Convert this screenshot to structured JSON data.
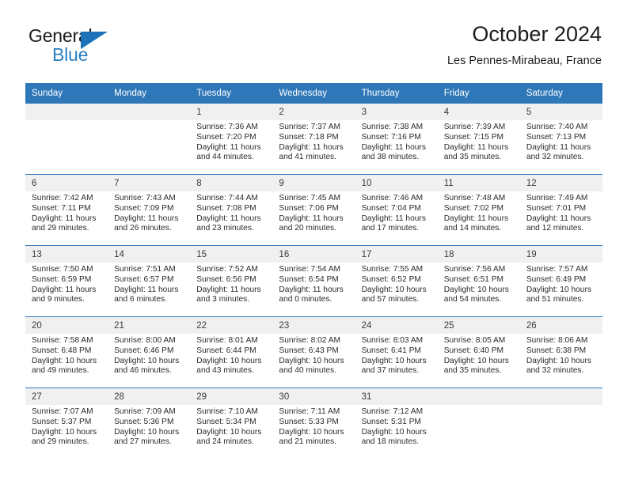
{
  "brand": {
    "name_top": "General",
    "name_bottom": "Blue",
    "triangle_color": "#1c72b8",
    "blue_text_color": "#2a7fc1"
  },
  "header": {
    "title": "October 2024",
    "subtitle": "Les Pennes-Mirabeau, France"
  },
  "theme": {
    "header_blue": "#2e77b8",
    "daynum_band": "#f0f0f0",
    "text": "#2b2b2b"
  },
  "weekdays": [
    "Sunday",
    "Monday",
    "Tuesday",
    "Wednesday",
    "Thursday",
    "Friday",
    "Saturday"
  ],
  "weeks": [
    [
      {
        "day": "",
        "lines": []
      },
      {
        "day": "",
        "lines": []
      },
      {
        "day": "1",
        "lines": [
          "Sunrise: 7:36 AM",
          "Sunset: 7:20 PM",
          "Daylight: 11 hours",
          "and 44 minutes."
        ]
      },
      {
        "day": "2",
        "lines": [
          "Sunrise: 7:37 AM",
          "Sunset: 7:18 PM",
          "Daylight: 11 hours",
          "and 41 minutes."
        ]
      },
      {
        "day": "3",
        "lines": [
          "Sunrise: 7:38 AM",
          "Sunset: 7:16 PM",
          "Daylight: 11 hours",
          "and 38 minutes."
        ]
      },
      {
        "day": "4",
        "lines": [
          "Sunrise: 7:39 AM",
          "Sunset: 7:15 PM",
          "Daylight: 11 hours",
          "and 35 minutes."
        ]
      },
      {
        "day": "5",
        "lines": [
          "Sunrise: 7:40 AM",
          "Sunset: 7:13 PM",
          "Daylight: 11 hours",
          "and 32 minutes."
        ]
      }
    ],
    [
      {
        "day": "6",
        "lines": [
          "Sunrise: 7:42 AM",
          "Sunset: 7:11 PM",
          "Daylight: 11 hours",
          "and 29 minutes."
        ]
      },
      {
        "day": "7",
        "lines": [
          "Sunrise: 7:43 AM",
          "Sunset: 7:09 PM",
          "Daylight: 11 hours",
          "and 26 minutes."
        ]
      },
      {
        "day": "8",
        "lines": [
          "Sunrise: 7:44 AM",
          "Sunset: 7:08 PM",
          "Daylight: 11 hours",
          "and 23 minutes."
        ]
      },
      {
        "day": "9",
        "lines": [
          "Sunrise: 7:45 AM",
          "Sunset: 7:06 PM",
          "Daylight: 11 hours",
          "and 20 minutes."
        ]
      },
      {
        "day": "10",
        "lines": [
          "Sunrise: 7:46 AM",
          "Sunset: 7:04 PM",
          "Daylight: 11 hours",
          "and 17 minutes."
        ]
      },
      {
        "day": "11",
        "lines": [
          "Sunrise: 7:48 AM",
          "Sunset: 7:02 PM",
          "Daylight: 11 hours",
          "and 14 minutes."
        ]
      },
      {
        "day": "12",
        "lines": [
          "Sunrise: 7:49 AM",
          "Sunset: 7:01 PM",
          "Daylight: 11 hours",
          "and 12 minutes."
        ]
      }
    ],
    [
      {
        "day": "13",
        "lines": [
          "Sunrise: 7:50 AM",
          "Sunset: 6:59 PM",
          "Daylight: 11 hours",
          "and 9 minutes."
        ]
      },
      {
        "day": "14",
        "lines": [
          "Sunrise: 7:51 AM",
          "Sunset: 6:57 PM",
          "Daylight: 11 hours",
          "and 6 minutes."
        ]
      },
      {
        "day": "15",
        "lines": [
          "Sunrise: 7:52 AM",
          "Sunset: 6:56 PM",
          "Daylight: 11 hours",
          "and 3 minutes."
        ]
      },
      {
        "day": "16",
        "lines": [
          "Sunrise: 7:54 AM",
          "Sunset: 6:54 PM",
          "Daylight: 11 hours",
          "and 0 minutes."
        ]
      },
      {
        "day": "17",
        "lines": [
          "Sunrise: 7:55 AM",
          "Sunset: 6:52 PM",
          "Daylight: 10 hours",
          "and 57 minutes."
        ]
      },
      {
        "day": "18",
        "lines": [
          "Sunrise: 7:56 AM",
          "Sunset: 6:51 PM",
          "Daylight: 10 hours",
          "and 54 minutes."
        ]
      },
      {
        "day": "19",
        "lines": [
          "Sunrise: 7:57 AM",
          "Sunset: 6:49 PM",
          "Daylight: 10 hours",
          "and 51 minutes."
        ]
      }
    ],
    [
      {
        "day": "20",
        "lines": [
          "Sunrise: 7:58 AM",
          "Sunset: 6:48 PM",
          "Daylight: 10 hours",
          "and 49 minutes."
        ]
      },
      {
        "day": "21",
        "lines": [
          "Sunrise: 8:00 AM",
          "Sunset: 6:46 PM",
          "Daylight: 10 hours",
          "and 46 minutes."
        ]
      },
      {
        "day": "22",
        "lines": [
          "Sunrise: 8:01 AM",
          "Sunset: 6:44 PM",
          "Daylight: 10 hours",
          "and 43 minutes."
        ]
      },
      {
        "day": "23",
        "lines": [
          "Sunrise: 8:02 AM",
          "Sunset: 6:43 PM",
          "Daylight: 10 hours",
          "and 40 minutes."
        ]
      },
      {
        "day": "24",
        "lines": [
          "Sunrise: 8:03 AM",
          "Sunset: 6:41 PM",
          "Daylight: 10 hours",
          "and 37 minutes."
        ]
      },
      {
        "day": "25",
        "lines": [
          "Sunrise: 8:05 AM",
          "Sunset: 6:40 PM",
          "Daylight: 10 hours",
          "and 35 minutes."
        ]
      },
      {
        "day": "26",
        "lines": [
          "Sunrise: 8:06 AM",
          "Sunset: 6:38 PM",
          "Daylight: 10 hours",
          "and 32 minutes."
        ]
      }
    ],
    [
      {
        "day": "27",
        "lines": [
          "Sunrise: 7:07 AM",
          "Sunset: 5:37 PM",
          "Daylight: 10 hours",
          "and 29 minutes."
        ]
      },
      {
        "day": "28",
        "lines": [
          "Sunrise: 7:09 AM",
          "Sunset: 5:36 PM",
          "Daylight: 10 hours",
          "and 27 minutes."
        ]
      },
      {
        "day": "29",
        "lines": [
          "Sunrise: 7:10 AM",
          "Sunset: 5:34 PM",
          "Daylight: 10 hours",
          "and 24 minutes."
        ]
      },
      {
        "day": "30",
        "lines": [
          "Sunrise: 7:11 AM",
          "Sunset: 5:33 PM",
          "Daylight: 10 hours",
          "and 21 minutes."
        ]
      },
      {
        "day": "31",
        "lines": [
          "Sunrise: 7:12 AM",
          "Sunset: 5:31 PM",
          "Daylight: 10 hours",
          "and 18 minutes."
        ]
      },
      {
        "day": "",
        "lines": []
      },
      {
        "day": "",
        "lines": []
      }
    ]
  ]
}
